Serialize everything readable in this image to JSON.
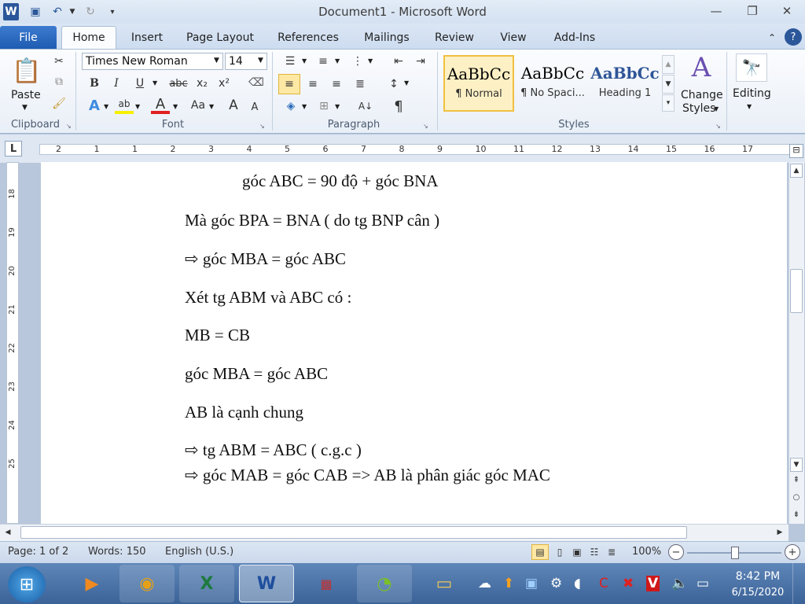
{
  "window": {
    "title": "Document1 - Microsoft Word"
  },
  "tabs": [
    "File",
    "Home",
    "Insert",
    "Page Layout",
    "References",
    "Mailings",
    "Review",
    "View",
    "Add-Ins"
  ],
  "clipboard": {
    "paste_label": "Paste",
    "group_label": "Clipboard"
  },
  "font": {
    "name": "Times New Roman",
    "size": "14",
    "group_label": "Font",
    "bold": "B",
    "italic": "I",
    "underline": "U",
    "strike": "abc",
    "subscript": "x₂",
    "superscript": "x²",
    "grow": "A",
    "shrink": "A",
    "case": "Aa",
    "color_a": "A",
    "highlight": "ab"
  },
  "paragraph": {
    "group_label": "Paragraph",
    "pilcrow": "¶"
  },
  "styles": {
    "group_label": "Styles",
    "items": [
      {
        "preview": "AaBbCc",
        "name": "¶ Normal"
      },
      {
        "preview": "AaBbCc",
        "name": "¶ No Spaci..."
      },
      {
        "preview": "AaBbCc",
        "name": "Heading 1"
      }
    ],
    "change_label_1": "Change",
    "change_label_2": "Styles"
  },
  "editing": {
    "label": "Editing"
  },
  "ruler": {
    "numbers": [
      "2",
      "1",
      "1",
      "2",
      "3",
      "4",
      "5",
      "6",
      "7",
      "8",
      "9",
      "10",
      "11",
      "12",
      "13",
      "14",
      "15",
      "16",
      "17"
    ],
    "vnumbers": [
      "18",
      "19",
      "20",
      "21",
      "22",
      "23",
      "24",
      "25"
    ],
    "tab_selector": "L"
  },
  "document": {
    "lines": [
      "góc ABC = 90 độ + góc BNA",
      "Mà góc BPA = BNA ( do tg BNP cân )",
      "⇨  góc MBA = góc ABC",
      "Xét tg ABM và ABC có :",
      " MB = CB",
      " góc MBA = góc ABC",
      "AB là cạnh chung",
      "⇨  tg ABM = ABC ( c.g.c )",
      "⇨  góc MAB = góc CAB => AB là phân giác góc MAC"
    ]
  },
  "status": {
    "page": "Page: 1 of 2",
    "words": "Words: 150",
    "language": "English (U.S.)",
    "zoom": "100%"
  },
  "clock": {
    "time": "8:42 PM",
    "date": "6/15/2020"
  },
  "colors": {
    "ribbon_blue": "#2b579a",
    "file_tab": "#1e5cb3",
    "taskbar": "#3b6398"
  }
}
